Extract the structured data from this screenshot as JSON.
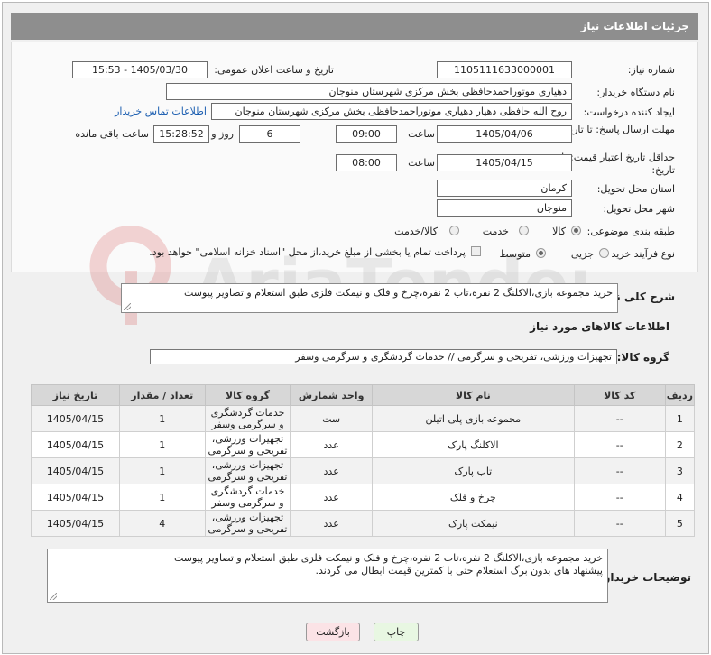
{
  "header": {
    "title": "جزئیات اطلاعات نیاز"
  },
  "fields": {
    "need_number_label": "شماره نیاز:",
    "need_number": "1105111633000001",
    "announce_label": "تاریخ و ساعت اعلان عمومی:",
    "announce_value": "1405/03/30 - 15:53",
    "buyer_org_label": "نام دستگاه خریدار:",
    "buyer_org": "دهیاری موتوراحمدحافظی بخش مرکزی شهرستان منوجان",
    "creator_label": "ایجاد کننده درخواست:",
    "creator": "روح الله حافظی دهیار دهیاری موتوراحمدحافظی بخش مرکزی شهرستان منوجان",
    "contact_link": "اطلاعات تماس خریدار",
    "deadline_label": "مهلت ارسال پاسخ: تا تاریخ:",
    "deadline_date": "1405/04/06",
    "time_label": "ساعت",
    "deadline_time": "09:00",
    "days": "6",
    "days_label": "روز و",
    "remaining_time": "15:28:52",
    "remaining_label": "ساعت باقی مانده",
    "validity_label": "حداقل تاریخ اعتبار قیمت: تا تاریخ:",
    "validity_date": "1405/04/15",
    "validity_time": "08:00",
    "province_label": "استان محل تحویل:",
    "province": "کرمان",
    "city_label": "شهر محل تحویل:",
    "city": "منوجان",
    "category_label": "طبقه بندی موضوعی:",
    "category_options": [
      "کالا",
      "خدمت",
      "کالا/خدمت"
    ],
    "process_label": "نوع فرآیند خرید :",
    "process_options": [
      "جزیی",
      "متوسط"
    ],
    "payment_note": "پرداخت تمام یا بخشی از مبلغ خرید،از محل \"اسناد خزانه اسلامی\" خواهد بود."
  },
  "summary": {
    "label": "شرح کلی نیاز:",
    "text": "خرید مجموعه بازی،الاکلنگ 2 نفره،تاب 2 نفره،چرخ و فلک و نیمکت فلزی طبق استعلام و تصاویر پیوست"
  },
  "goods": {
    "section_title": "اطلاعات کالاهای مورد نیاز",
    "group_label": "گروه کالا:",
    "group_value": "تجهیزات ورزشی، تفریحی و سرگرمی // خدمات گردشگری و سرگرمی وسفر",
    "columns": [
      "ردیف",
      "کد کالا",
      "نام کالا",
      "واحد شمارش",
      "گروه کالا",
      "تعداد / مقدار",
      "تاریخ نیاز"
    ],
    "rows": [
      {
        "row": "1",
        "code": "--",
        "name": "مجموعه بازی پلی اتیلن",
        "unit": "ست",
        "group": "خدمات گردشگری و سرگرمی وسفر",
        "qty": "1",
        "date": "1405/04/15"
      },
      {
        "row": "2",
        "code": "--",
        "name": "الاکلنگ پارک",
        "unit": "عدد",
        "group": "تجهیزات ورزشی، تفریحی و سرگرمی",
        "qty": "1",
        "date": "1405/04/15"
      },
      {
        "row": "3",
        "code": "--",
        "name": "تاب پارک",
        "unit": "عدد",
        "group": "تجهیزات ورزشی، تفریحی و سرگرمی",
        "qty": "1",
        "date": "1405/04/15"
      },
      {
        "row": "4",
        "code": "--",
        "name": "چرخ و فلک",
        "unit": "عدد",
        "group": "خدمات گردشگری و سرگرمی وسفر",
        "qty": "1",
        "date": "1405/04/15"
      },
      {
        "row": "5",
        "code": "--",
        "name": "نیمکت پارک",
        "unit": "عدد",
        "group": "تجهیزات ورزشی، تفریحی و سرگرمی",
        "qty": "4",
        "date": "1405/04/15"
      }
    ]
  },
  "buyer_notes": {
    "label": "توضیحات خریدار:",
    "line1": "خرید مجموعه بازی،الاکلنگ 2 نفره،تاب 2 نفره،چرخ و فلک و نیمکت فلزی طبق استعلام و تصاویر پیوست",
    "line2": "پیشنهاد های بدون برگ استعلام حتی با کمترین قیمت ابطال می گردند."
  },
  "buttons": {
    "print": "چاپ",
    "back": "بازگشت"
  },
  "watermark_text": "AriaTender.neT",
  "colors": {
    "header_bg": "#8e8e8e",
    "print_bg": "#e8f7e2",
    "back_bg": "#fbe3e6",
    "link": "#1a5db0"
  }
}
